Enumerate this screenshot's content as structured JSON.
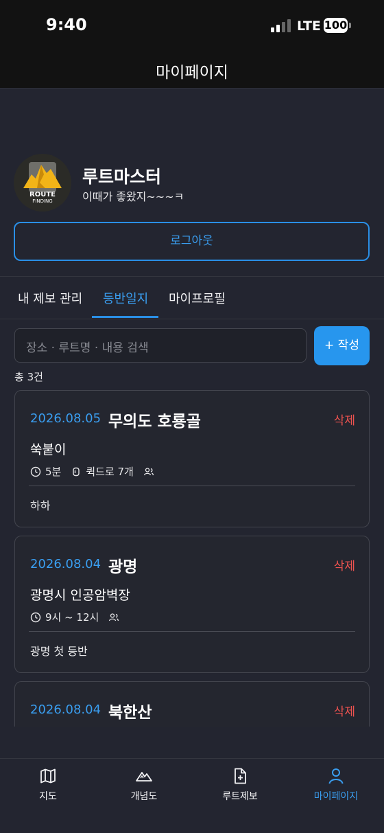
{
  "status_bar": {
    "time": "9:40",
    "network": "LTE",
    "battery": "100"
  },
  "header": {
    "title": "마이페이지"
  },
  "profile": {
    "logo_text_line1": "ROUTE",
    "logo_text_line2": "FINDING",
    "name": "루트마스터",
    "bio": "이때가 좋왔지~~~ㅋ",
    "logout_label": "로그아웃"
  },
  "tabs": [
    {
      "label": "내 제보 관리",
      "active": false
    },
    {
      "label": "등반일지",
      "active": true
    },
    {
      "label": "마이프로필",
      "active": false
    }
  ],
  "search": {
    "placeholder": "장소 · 루트명 · 내용 검색"
  },
  "write_button": "+ 작성",
  "count_text": "총 3건",
  "delete_label": "삭제",
  "logs": [
    {
      "date": "2026.08.05",
      "place": "무의도 호룡골",
      "route": "쑥붙이",
      "duration": "5분",
      "gear": "퀵드로 7개",
      "note": "하하"
    },
    {
      "date": "2026.08.04",
      "place": "광명",
      "route": "광명시 인공암벽장",
      "duration": "9시 ~ 12시",
      "note": "광명 첫 등반"
    },
    {
      "date": "2026.08.04",
      "place": "북한산"
    }
  ],
  "bottom_nav": [
    {
      "label": "지도",
      "icon": "map-icon",
      "active": false
    },
    {
      "label": "개념도",
      "icon": "mountain-icon",
      "active": false
    },
    {
      "label": "루트제보",
      "icon": "file-plus-icon",
      "active": false
    },
    {
      "label": "마이페이지",
      "icon": "user-icon",
      "active": true
    }
  ],
  "colors": {
    "accent": "#2a8fe6",
    "danger": "#ef5350",
    "background": "#232530"
  }
}
